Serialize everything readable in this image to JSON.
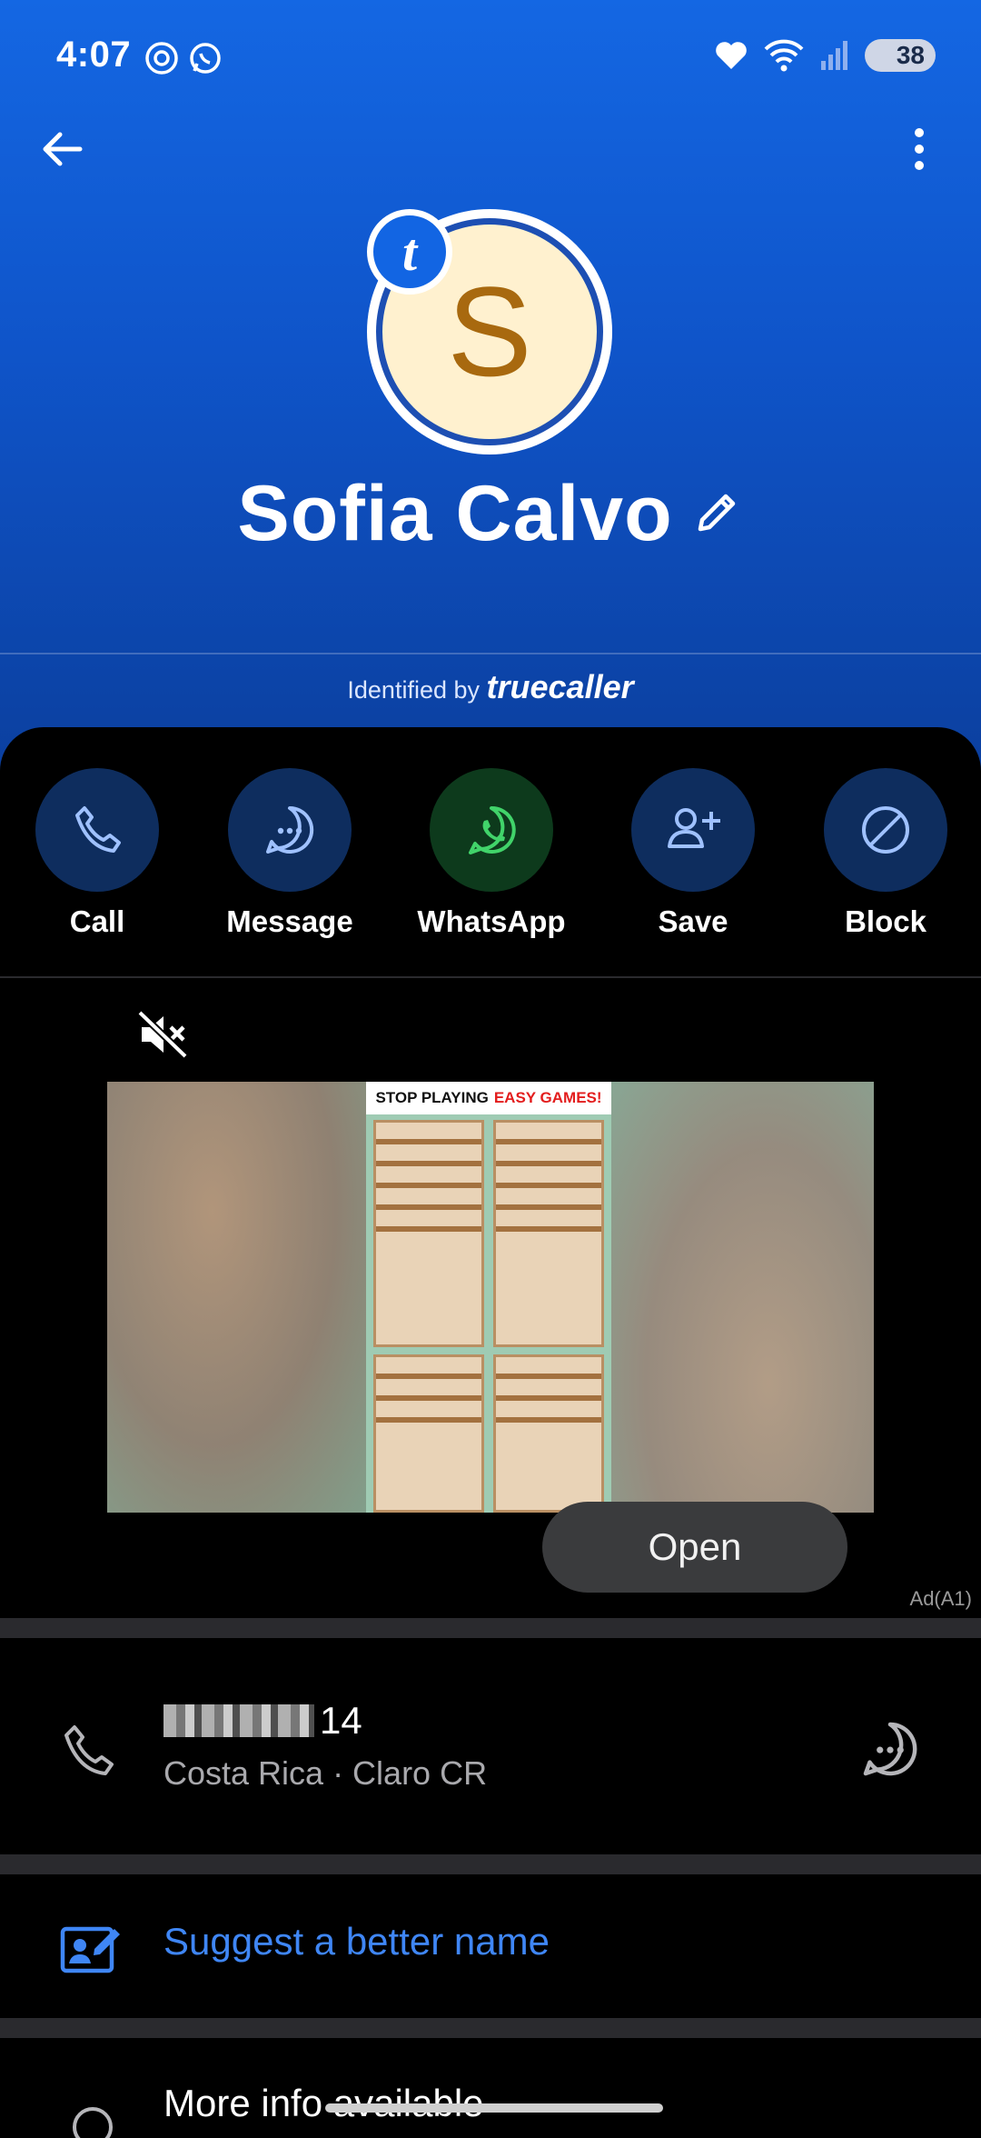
{
  "status_bar": {
    "time": "4:07",
    "battery": "38",
    "icons": [
      "threads-icon",
      "whatsapp-icon",
      "heart-icon",
      "wifi-icon",
      "signal-icon",
      "battery-icon"
    ]
  },
  "toolbar": {
    "back_icon": "arrow-left-icon",
    "more_icon": "more-vertical-icon"
  },
  "profile": {
    "avatar_letter": "S",
    "badge_letter": "t",
    "name": "Sofia Calvo",
    "edit_icon": "pencil-icon",
    "identified_prefix": "Identified by",
    "identified_brand": "truecaller"
  },
  "actions": [
    {
      "label": "Call",
      "icon": "phone-icon"
    },
    {
      "label": "Message",
      "icon": "chat-bubble-icon"
    },
    {
      "label": "WhatsApp",
      "icon": "whatsapp-icon"
    },
    {
      "label": "Save",
      "icon": "add-person-icon"
    },
    {
      "label": "Block",
      "icon": "block-icon"
    }
  ],
  "ad": {
    "banner_text_a": "STOP PLAYING",
    "banner_text_b": "EASY GAMES!",
    "open_label": "Open",
    "ad_label": "Ad(A1)",
    "mute_icon": "volume-mute-icon"
  },
  "phone": {
    "number_suffix": "14",
    "carrier": "Costa Rica · Claro CR"
  },
  "suggest": {
    "label": "Suggest a better name"
  },
  "more_info": {
    "label": "More info available"
  },
  "colors": {
    "header_blue": "#1467e3",
    "action_circle": "#0e2d5e",
    "whatsapp_circle": "#0d3a1c",
    "link_blue": "#3f86f5"
  }
}
